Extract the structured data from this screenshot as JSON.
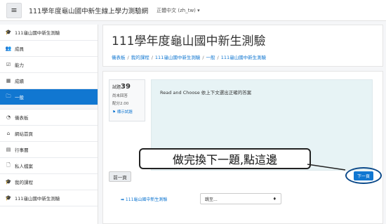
{
  "topbar": {
    "menu_icon": "hamburger-icon",
    "site_title": "111學年度龜山國中新生線上學力測驗網",
    "language": "正體中文 (zh_tw) ▾"
  },
  "sidebar": {
    "items": [
      {
        "icon": "graduation-cap-icon",
        "glyph": "🎓",
        "label": "111龜山國中新生測驗"
      },
      {
        "icon": "users-icon",
        "glyph": "👥",
        "label": "成員"
      },
      {
        "icon": "badge-check-icon",
        "glyph": "☑",
        "label": "能力"
      },
      {
        "icon": "table-icon",
        "glyph": "▦",
        "label": "成績"
      },
      {
        "icon": "folder-icon",
        "glyph": "🗀",
        "label": "一般",
        "active": true
      },
      {
        "icon": "dashboard-icon",
        "glyph": "◔",
        "label": "儀表板"
      },
      {
        "icon": "home-icon",
        "glyph": "⌂",
        "label": "網站首頁"
      },
      {
        "icon": "calendar-icon",
        "glyph": "▤",
        "label": "行事曆"
      },
      {
        "icon": "file-icon",
        "glyph": "🗋",
        "label": "私人檔案"
      },
      {
        "icon": "graduation-cap-icon",
        "glyph": "🎓",
        "label": "我的課程"
      },
      {
        "icon": "graduation-cap-icon",
        "glyph": "🎓",
        "label": "111龜山國中新生測驗"
      }
    ]
  },
  "header": {
    "title": "111學年度龜山國中新生測驗",
    "breadcrumb": [
      "儀表板",
      "我的課程",
      "111龜山國中新生測驗",
      "一般",
      "111龜山國中新生測驗"
    ]
  },
  "question": {
    "number_label": "試題",
    "number": "39",
    "status": "尚未回答",
    "points": "配分2.00",
    "flag": "標示試題",
    "flag_icon": "flag-icon",
    "text": "Read and Choose 依上下文選出正確的答案"
  },
  "nav": {
    "prev": "前一頁",
    "next": "下一頁",
    "back_link": "➡ 111龜山國中新生測驗",
    "jump_placeholder": "跳至...",
    "jump_arrow": "♦"
  },
  "annotation": {
    "text": "做完換下一題,點這邊"
  }
}
